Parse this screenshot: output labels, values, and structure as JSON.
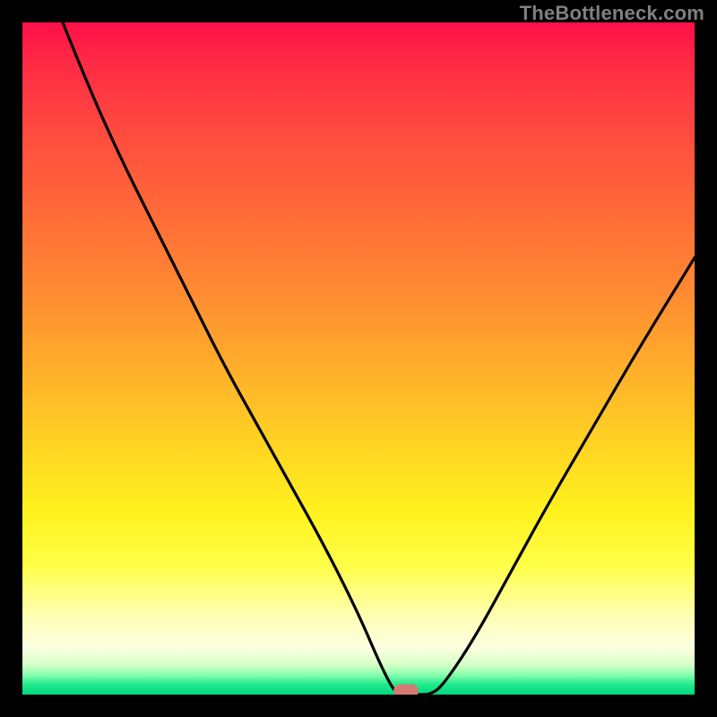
{
  "watermark": "TheBottleneck.com",
  "chart_data": {
    "type": "line",
    "title": "",
    "xlabel": "",
    "ylabel": "",
    "xlim": [
      0,
      100
    ],
    "ylim": [
      0,
      100
    ],
    "grid": false,
    "legend": false,
    "background_gradient": {
      "orientation": "vertical",
      "stops": [
        {
          "pct": 0,
          "color": "#ff1048"
        },
        {
          "pct": 16,
          "color": "#ff4a3f"
        },
        {
          "pct": 40,
          "color": "#ff8a32"
        },
        {
          "pct": 63,
          "color": "#ffd423"
        },
        {
          "pct": 81,
          "color": "#ffff4a"
        },
        {
          "pct": 93,
          "color": "#fbffe0"
        },
        {
          "pct": 97,
          "color": "#8cffb0"
        },
        {
          "pct": 100,
          "color": "#00d880"
        }
      ]
    },
    "series": [
      {
        "name": "bottleneck-curve",
        "color": "#000000",
        "x": [
          6,
          10,
          15,
          20,
          25,
          30,
          35,
          40,
          45,
          50,
          53,
          55,
          56,
          58,
          61,
          63,
          67,
          72,
          78,
          85,
          92,
          100
        ],
        "y": [
          100,
          90,
          79,
          69,
          59,
          49,
          40,
          31,
          22,
          12,
          5,
          1,
          0,
          0,
          0,
          2,
          8,
          17,
          28,
          40,
          52,
          65
        ]
      }
    ],
    "marker": {
      "x": 57,
      "y": 0.6,
      "color": "#d77a74",
      "shape": "pill"
    }
  }
}
